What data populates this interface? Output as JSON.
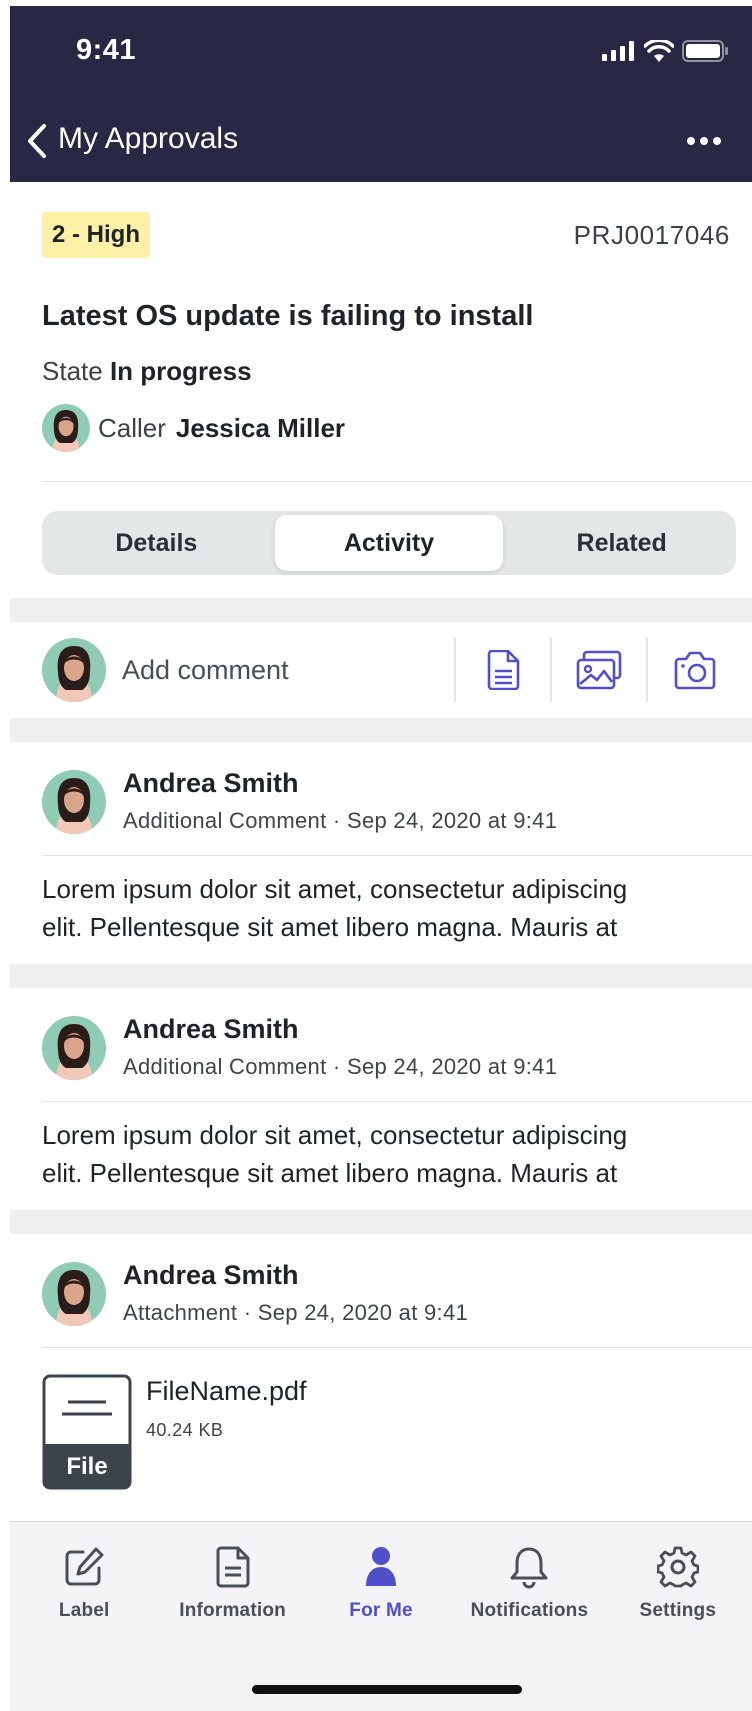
{
  "status_bar": {
    "time": "9:41"
  },
  "nav": {
    "title": "My Approvals"
  },
  "record": {
    "priority": "2 - High",
    "number": "PRJ0017046",
    "title": "Latest OS update is failing to install",
    "state_label": "State",
    "state_value": "In progress",
    "caller_label": "Caller",
    "caller_name": "Jessica Miller"
  },
  "tabs": [
    {
      "label": "Details",
      "active": false
    },
    {
      "label": "Activity",
      "active": true
    },
    {
      "label": "Related",
      "active": false
    }
  ],
  "composer": {
    "placeholder": "Add comment"
  },
  "activity": [
    {
      "author": "Andrea Smith",
      "type": "Additional Comment",
      "date": "Sep 24, 2020 at 9:41",
      "line1": "Lorem ipsum dolor sit amet, consectetur adipiscing",
      "line2": "elit. Pellentesque sit amet libero magna. Mauris at"
    },
    {
      "author": "Andrea Smith",
      "type": "Additional Comment",
      "date": "Sep 24, 2020 at 9:41",
      "line1": "Lorem ipsum dolor sit amet, consectetur adipiscing",
      "line2": "elit. Pellentesque sit amet libero magna. Mauris at"
    },
    {
      "author": "Andrea Smith",
      "type": "Attachment",
      "date": "Sep 24, 2020 at 9:41",
      "file_name": "FileName.pdf",
      "file_size": "40.24 KB",
      "file_icon_label": "File"
    }
  ],
  "bottom_tabs": [
    {
      "label": "Label",
      "icon": "edit-icon",
      "active": false
    },
    {
      "label": "Information",
      "icon": "document-icon",
      "active": false
    },
    {
      "label": "For Me",
      "icon": "person-icon",
      "active": true
    },
    {
      "label": "Notifications",
      "icon": "bell-icon",
      "active": false
    },
    {
      "label": "Settings",
      "icon": "gear-icon",
      "active": false
    }
  ],
  "colors": {
    "header": "#282744",
    "accent": "#4f4fc9",
    "priority_bg": "#fdf1a8"
  }
}
